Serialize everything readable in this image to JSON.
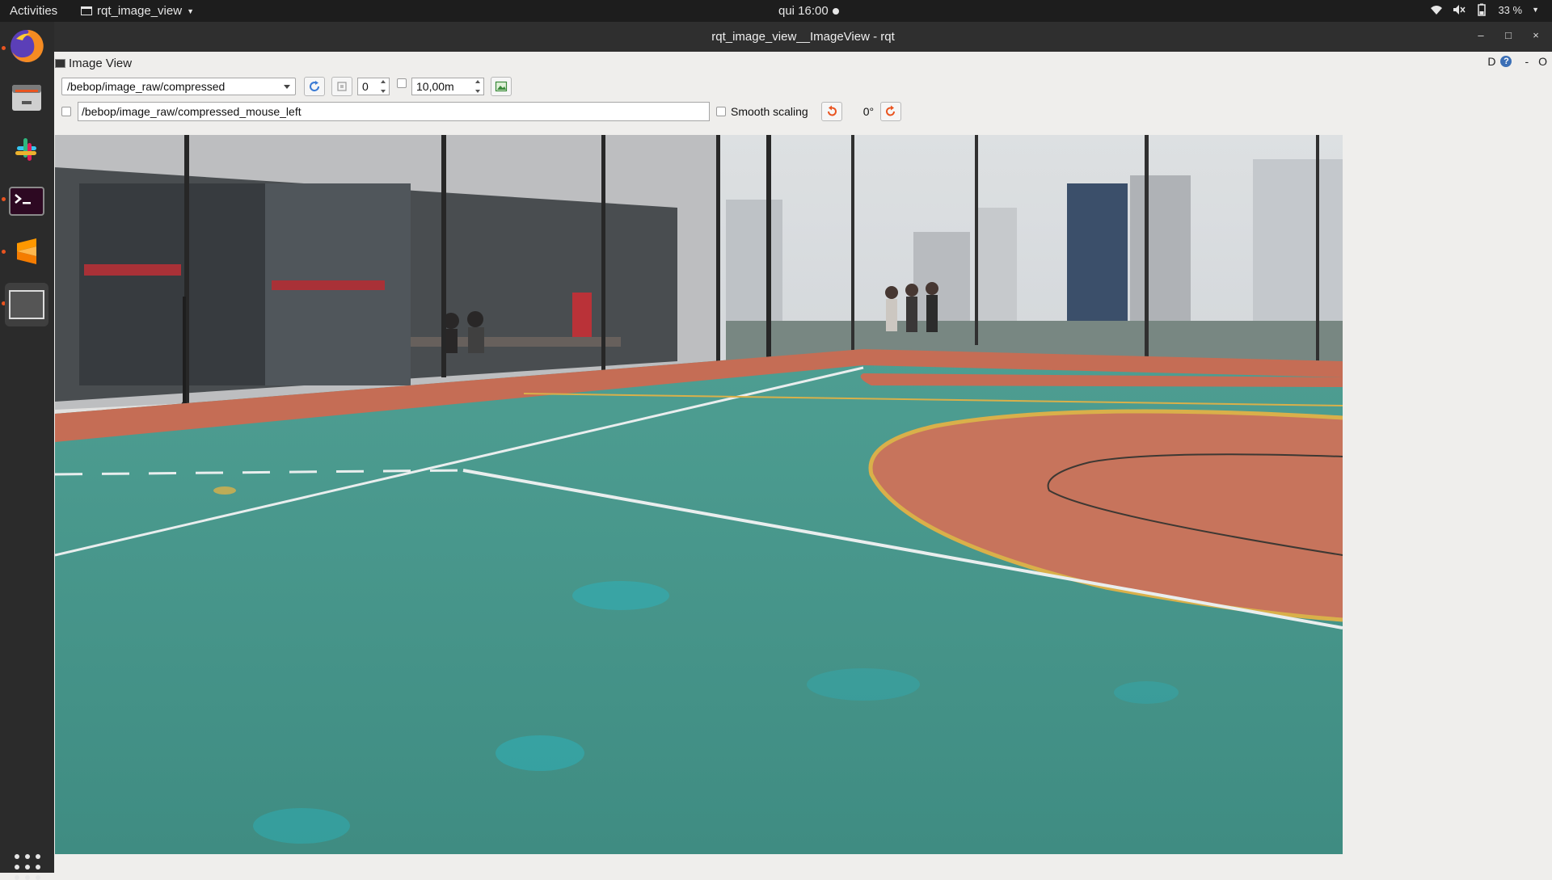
{
  "topbar": {
    "activities": "Activities",
    "app_menu": "rqt_image_view",
    "clock": "qui 16:00",
    "battery": "33 %"
  },
  "dock": {
    "items": [
      {
        "name": "firefox",
        "running": true
      },
      {
        "name": "files",
        "running": false
      },
      {
        "name": "slack",
        "running": false
      },
      {
        "name": "terminal",
        "running": true
      },
      {
        "name": "sublime-text",
        "running": true
      },
      {
        "name": "rqt-window",
        "running": true
      }
    ]
  },
  "window": {
    "title": "rqt_image_view__ImageView - rqt",
    "minimize": "–",
    "maximize": "□",
    "close": "×"
  },
  "plugin": {
    "title": "Image View",
    "tool_d": "D",
    "tool_help": "?",
    "tool_dash": "-",
    "tool_o": "O"
  },
  "toolbar": {
    "topic": "/bebop/image_raw/compressed",
    "spin_value": "0",
    "duration": "10,00m",
    "mouse_topic": "/bebop/image_raw/compressed_mouse_left",
    "smooth_scaling": "Smooth scaling",
    "rotation": "0°"
  },
  "colors": {
    "court_green": "#4f9a8f",
    "court_red": "#c8765f",
    "ubuntu_orange": "#e95420"
  }
}
